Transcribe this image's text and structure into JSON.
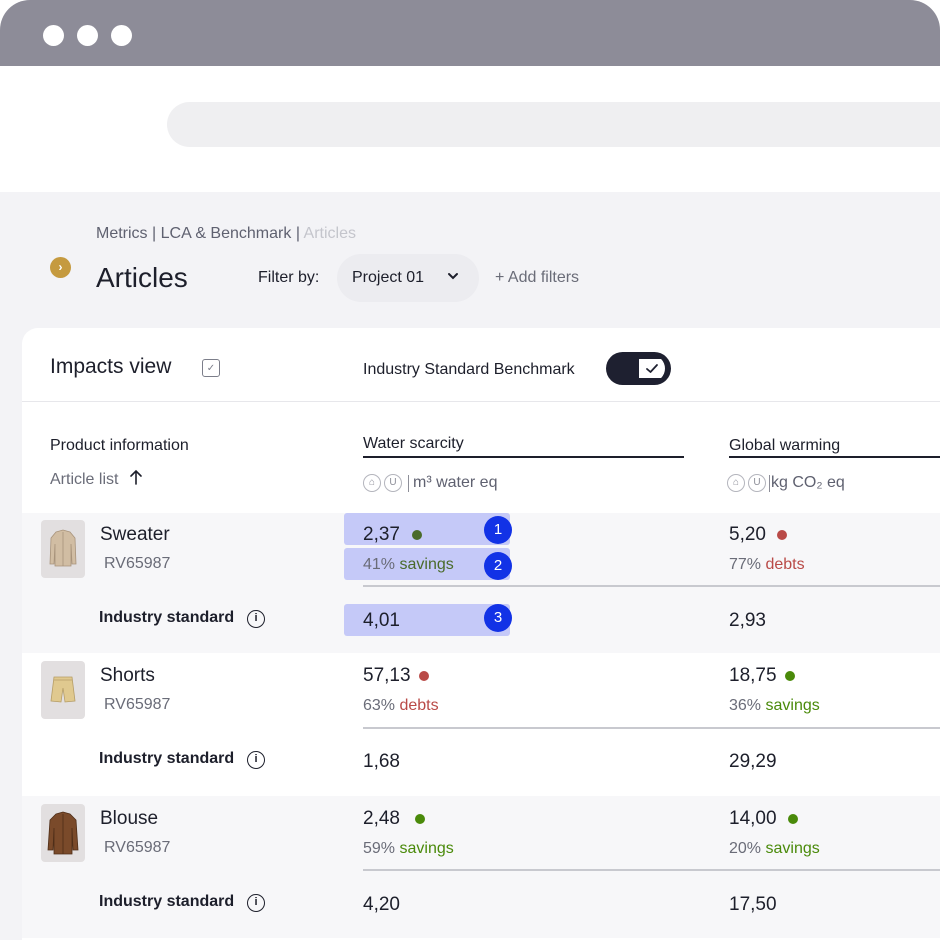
{
  "breadcrumb": {
    "part1": "Metrics",
    "part2": "LCA & Benchmark",
    "current": "Articles",
    "separator": "|"
  },
  "page": {
    "title": "Articles",
    "filter_label": "Filter by:",
    "filter_value": "Project 01",
    "add_filters": "+ Add filters"
  },
  "card": {
    "view_title": "Impacts view",
    "benchmark_label": "Industry Standard Benchmark",
    "benchmark_on": true
  },
  "columns": {
    "product_info": "Product information",
    "article_list": "Article list",
    "sort_icon": "arrow-up-icon",
    "water": {
      "title": "Water scarcity",
      "unit": "m³ water eq"
    },
    "warming": {
      "title": "Global warming",
      "unit": "kg CO₂ eq"
    }
  },
  "colors": {
    "savings": "#4a8a0a",
    "debts": "#b94a47",
    "highlight": "#c5c9f8",
    "marker": "#1232e6",
    "accent": "#c59a3f"
  },
  "std_label": "Industry standard",
  "rows": [
    {
      "name": "Sweater",
      "code": "RV65987",
      "water": {
        "value": "2,37",
        "status": "savings",
        "pct": "41%",
        "word": "savings",
        "standard": "4,01"
      },
      "warming": {
        "value": "5,20",
        "status": "debts",
        "pct": "77%",
        "word": "debts",
        "standard": "2,93"
      }
    },
    {
      "name": "Shorts",
      "code": "RV65987",
      "water": {
        "value": "57,13",
        "status": "debts",
        "pct": "63%",
        "word": "debts",
        "standard": "1,68"
      },
      "warming": {
        "value": "18,75",
        "status": "savings",
        "pct": "36%",
        "word": "savings",
        "standard": "29,29"
      }
    },
    {
      "name": "Blouse",
      "code": "RV65987",
      "water": {
        "value": "2,48",
        "status": "savings",
        "pct": "59%",
        "word": "savings",
        "standard": "4,20"
      },
      "warming": {
        "value": "14,00",
        "status": "savings",
        "pct": "20%",
        "word": "savings",
        "standard": "17,50"
      }
    }
  ],
  "markers": [
    "1",
    "2",
    "3"
  ]
}
